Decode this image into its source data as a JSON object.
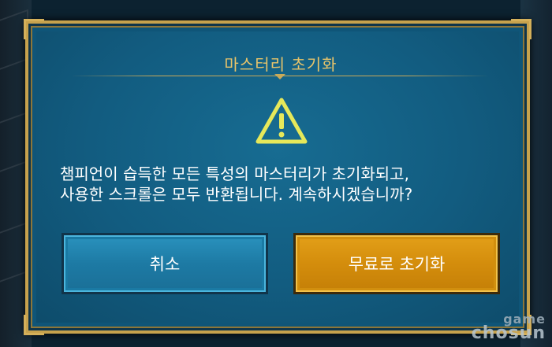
{
  "dialog": {
    "title": "마스터리 초기화",
    "icon": "warning-icon",
    "message_line1": "챔피언이 습득한 모든 특성의 마스터리가 초기화되고,",
    "message_line2": "사용한 스크롤은 모두 반환됩니다. 계속하시겠습니까?",
    "cancel_label": "취소",
    "confirm_label": "무료로 초기화"
  },
  "watermark": {
    "line1": "game",
    "line2": "chosun"
  },
  "colors": {
    "panel": "#125c80",
    "frame_gold": "#c7a24d",
    "title_gold": "#e8c46a",
    "warning_yellow": "#e6e85a",
    "cancel_blue": "#1d7aa4",
    "confirm_orange": "#d48d0c"
  }
}
